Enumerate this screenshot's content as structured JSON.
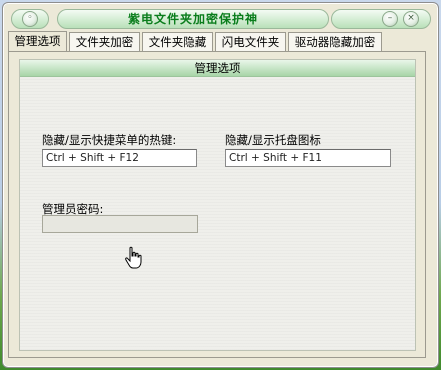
{
  "window": {
    "title": "紫电文件夹加密保护神"
  },
  "controls": {
    "menu_glyph": "◦",
    "minimize_glyph": "–",
    "close_glyph": "×"
  },
  "tabs": [
    {
      "label": "管理选项"
    },
    {
      "label": "文件夹加密"
    },
    {
      "label": "文件夹隐藏"
    },
    {
      "label": "闪电文件夹"
    },
    {
      "label": "驱动器隐藏加密"
    }
  ],
  "panel": {
    "group_title": "管理选项",
    "hotkey_menu_label": "隐藏/显示快捷菜单的热键:",
    "hotkey_menu_value": "Ctrl + Shift + F12",
    "hotkey_tray_label": "隐藏/显示托盘图标",
    "hotkey_tray_value": "Ctrl + Shift + F11",
    "admin_password_label": "管理员密码:",
    "admin_password_value": ""
  },
  "icons": {
    "cursor": "hand-pointer-icon"
  }
}
